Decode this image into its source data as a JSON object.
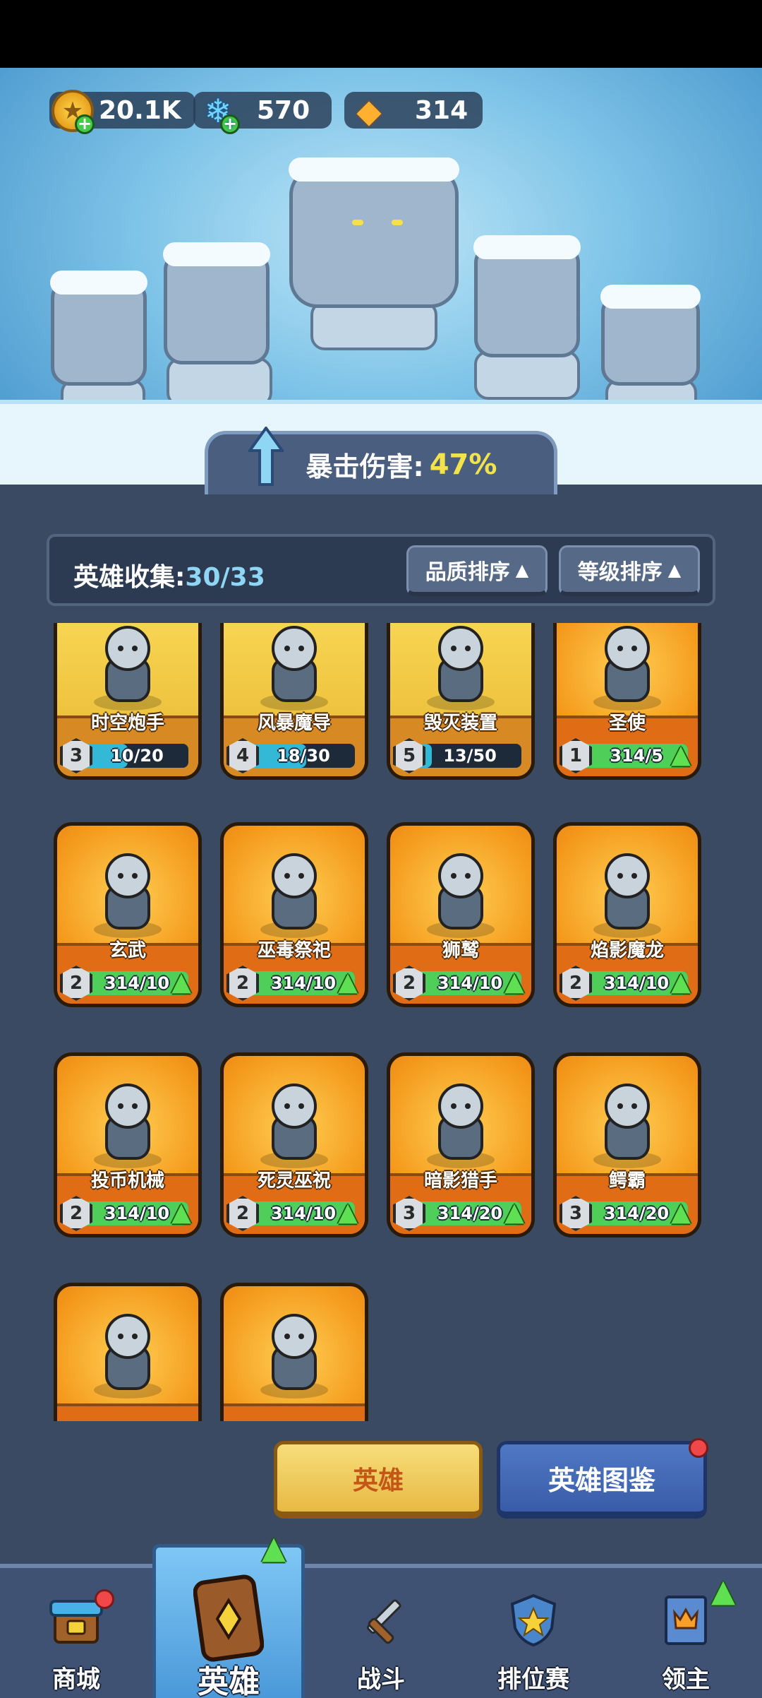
{
  "currency": {
    "gold": {
      "value": "20.1K",
      "icon": "gold-coin-icon"
    },
    "gems": {
      "value": "570",
      "icon": "blue-gem-icon"
    },
    "crystals": {
      "value": "314",
      "icon": "orange-crystal-icon"
    }
  },
  "bonus": {
    "label": "暴击伤害:",
    "value": "47%"
  },
  "collection": {
    "label": "英雄收集:",
    "value": "30/33",
    "sort_quality": "品质排序",
    "sort_level": "等级排序"
  },
  "heroes": [
    {
      "name": "时空炮手",
      "level": "3",
      "progress": "10/20",
      "fill": 0.5,
      "tier": "gold",
      "upgrade": false
    },
    {
      "name": "风暴魔导",
      "level": "4",
      "progress": "18/30",
      "fill": 0.6,
      "tier": "gold",
      "upgrade": false
    },
    {
      "name": "毁灭装置",
      "level": "5",
      "progress": "13/50",
      "fill": 0.26,
      "tier": "gold",
      "upgrade": false
    },
    {
      "name": "圣使",
      "level": "1",
      "progress": "314/5",
      "fill": 1,
      "tier": "orange",
      "upgrade": true
    },
    {
      "name": "玄武",
      "level": "2",
      "progress": "314/10",
      "fill": 1,
      "tier": "orange",
      "upgrade": true
    },
    {
      "name": "巫毒祭祀",
      "level": "2",
      "progress": "314/10",
      "fill": 1,
      "tier": "orange",
      "upgrade": true
    },
    {
      "name": "狮鹫",
      "level": "2",
      "progress": "314/10",
      "fill": 1,
      "tier": "orange",
      "upgrade": true
    },
    {
      "name": "焰影魔龙",
      "level": "2",
      "progress": "314/10",
      "fill": 1,
      "tier": "orange",
      "upgrade": true
    },
    {
      "name": "投币机械",
      "level": "2",
      "progress": "314/10",
      "fill": 1,
      "tier": "orange",
      "upgrade": true
    },
    {
      "name": "死灵巫祝",
      "level": "2",
      "progress": "314/10",
      "fill": 1,
      "tier": "orange",
      "upgrade": true
    },
    {
      "name": "暗影猎手",
      "level": "3",
      "progress": "314/20",
      "fill": 1,
      "tier": "orange",
      "upgrade": true
    },
    {
      "name": "鳄霸",
      "level": "3",
      "progress": "314/20",
      "fill": 1,
      "tier": "orange",
      "upgrade": true
    },
    {
      "name": "",
      "level": "",
      "progress": "",
      "fill": 0,
      "tier": "orange",
      "upgrade": false
    },
    {
      "name": "",
      "level": "",
      "progress": "",
      "fill": 0,
      "tier": "orange",
      "upgrade": false
    }
  ],
  "buttons": {
    "hero": "英雄",
    "codex": "英雄图鉴"
  },
  "nav": [
    {
      "label": "商城",
      "icon": "shop-icon",
      "active": false
    },
    {
      "label": "英雄",
      "icon": "hero-card-icon",
      "active": true
    },
    {
      "label": "战斗",
      "icon": "battle-icon",
      "active": false
    },
    {
      "label": "排位赛",
      "icon": "ranked-shield-icon",
      "active": false
    },
    {
      "label": "领主",
      "icon": "lord-banner-icon",
      "active": false
    }
  ],
  "colors": {
    "accent_gold": "#f2e34a",
    "collection_value": "#8fd6f5",
    "upgrade_green": "#5fe052",
    "notify_red": "#f04848"
  }
}
